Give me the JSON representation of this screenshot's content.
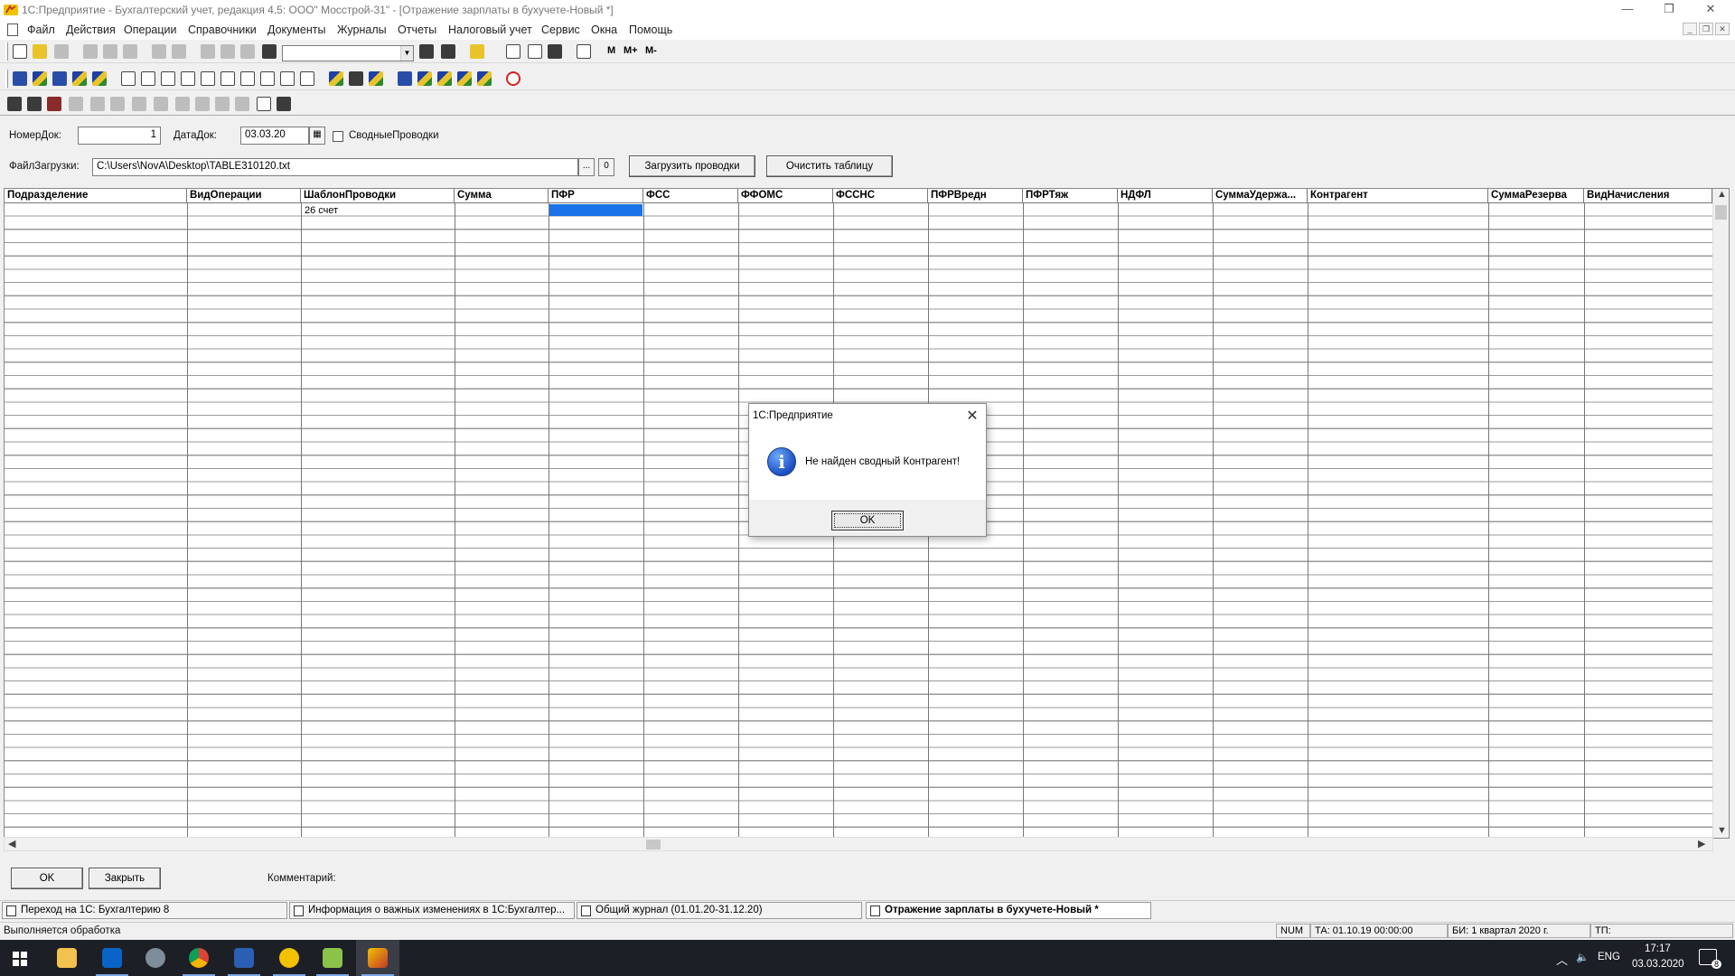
{
  "window": {
    "title": "1С:Предприятие - Бухгалтерский учет, редакция 4.5: ООО\" Мосстрой-31\" - [Отражение зарплаты в бухучете-Новый *]",
    "controls": [
      "—",
      "❐",
      "✕"
    ]
  },
  "menu": [
    "Файл",
    "Действия",
    "Операции",
    "Справочники",
    "Документы",
    "Журналы",
    "Отчеты",
    "Налоговый учет",
    "Сервис",
    "Окна",
    "Помощь"
  ],
  "toolbar": {
    "m_labels": [
      "M",
      "M+",
      "M-"
    ]
  },
  "form": {
    "nomer_label": "НомерДок:",
    "nomer_value": "1",
    "data_label": "ДатаДок:",
    "data_value": "03.03.20",
    "svodnye_label": "СводныеПроводки",
    "svodnye_checked": false,
    "file_label": "ФайлЗагрузки:",
    "file_value": "C:\\Users\\NovA\\Desktop\\TABLE310120.txt",
    "browse_label": "...",
    "zero_label": "0",
    "load_button": "Загрузить проводки",
    "clear_button": "Очистить таблицу"
  },
  "table": {
    "columns": [
      "Подразделение",
      "ВидОперации",
      "ШаблонПроводки",
      "Сумма",
      "ПФР",
      "ФСС",
      "ФФОМС",
      "ФССНС",
      "ПФРВредн",
      "ПФРТяж",
      "НДФЛ",
      "СуммаУдержа...",
      "Контрагент",
      "СуммаРезерва",
      "ВидНачисления"
    ],
    "first_row": [
      "",
      "",
      "26 счет",
      "",
      "",
      "",
      "",
      "",
      "",
      "",
      "",
      "",
      "",
      "",
      ""
    ],
    "selected_column": "ПФР"
  },
  "bottom": {
    "ok": "OK",
    "close": "Закрыть",
    "comment_label": "Комментарий:"
  },
  "mdi_tabs": [
    "Переход на 1С: Бухгалтерию 8",
    "Информация о важных изменениях в 1С:Бухгалтер...",
    "Общий журнал (01.01.20-31.12.20)",
    "Отражение зарплаты в бухучете-Новый *"
  ],
  "status": {
    "message": "Выполняется обработка",
    "num": "NUM",
    "ta": "ТА: 01.10.19  00:00:00",
    "bi": "БИ: 1 квартал 2020 г.",
    "tp": "ТП:"
  },
  "dialog": {
    "title": "1С:Предприятие",
    "message": "Не найден сводный Контрагент!",
    "ok": "OK",
    "close": "✕",
    "icon": "info-icon"
  },
  "taskbar": {
    "lang": "ENG",
    "time": "17:17",
    "date": "03.03.2020",
    "notify_count": "8",
    "apps": [
      "windows-start",
      "file-explorer",
      "outlook",
      "app-tool",
      "chrome",
      "remote-desktop",
      "1c-app",
      "android-app",
      "1c-enterprise"
    ]
  },
  "colors": {
    "selection": "#1a73e8",
    "taskbar": "#1c1f26",
    "dialog_footer": "#f0f0f0"
  }
}
